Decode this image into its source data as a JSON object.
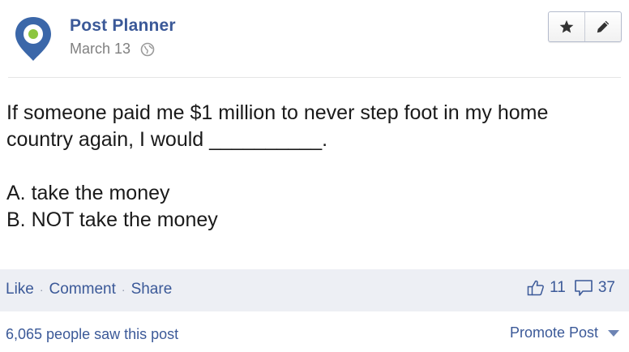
{
  "post": {
    "author": "Post Planner",
    "date": "March 13",
    "icons": {
      "avatar": "post-planner-logo",
      "privacy": "globe-icon",
      "star": "star-icon",
      "edit": "pencil-icon",
      "like_count": "thumbs-up-icon",
      "comment_count": "comment-bubble-icon"
    },
    "body_lines": [
      "If someone paid me $1 million to never step foot in my home",
      "country again, I would __________.",
      "A. take the money",
      "B. NOT take the money"
    ]
  },
  "action_bar": {
    "like": "Like",
    "comment": "Comment",
    "share": "Share",
    "like_count": "11",
    "comment_count": "37"
  },
  "footer": {
    "seen": "6,065 people saw this post",
    "promote": "Promote Post"
  },
  "colors": {
    "link": "#3b5998",
    "bar_bg": "#edeff4",
    "logo_blue": "#3b67a9",
    "logo_green": "#8cc63f"
  }
}
